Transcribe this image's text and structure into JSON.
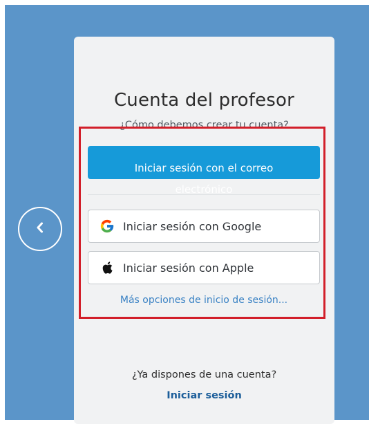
{
  "colors": {
    "background": "#5b95c9",
    "card": "#f1f2f3",
    "primary_button": "#169ad9",
    "highlight_border": "#d21f2a",
    "link": "#3a82c4"
  },
  "card": {
    "title": "Cuenta del profesor",
    "subtitle": "¿Cómo debemos crear tu cuenta?"
  },
  "buttons": {
    "email_line1": "Iniciar sesión con el correo",
    "email_line2": "electrónico",
    "google": "Iniciar sesión con Google",
    "apple": "Iniciar sesión con Apple"
  },
  "links": {
    "more_options": "Más opciones de inicio de sesión...",
    "already_account": "¿Ya dispones de una cuenta?",
    "login": "Iniciar sesión"
  },
  "icons": {
    "back": "chevron-left-icon",
    "google": "google-icon",
    "apple": "apple-icon"
  }
}
